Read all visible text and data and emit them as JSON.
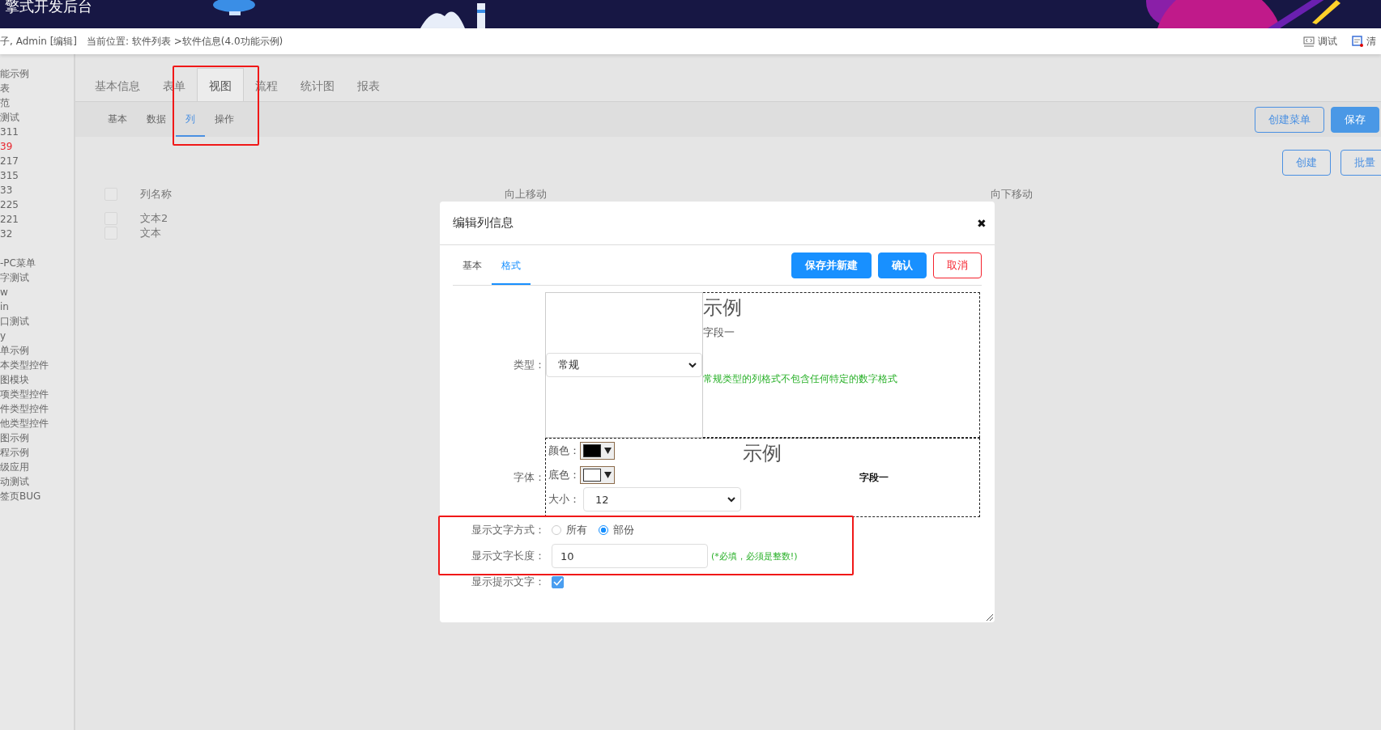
{
  "header": {
    "title": "擎式开发后台"
  },
  "breadcrumb": {
    "user": "子, Admin [编辑]",
    "location": "当前位置: 软件列表 >软件信息(4.0功能示例)"
  },
  "toolbar_links": [
    {
      "label": "调试",
      "kind": "debug"
    },
    {
      "label": "清",
      "kind": "clear"
    }
  ],
  "sidebar": {
    "groups": [
      {
        "items": [
          {
            "label": "能示例",
            "selected": false
          },
          {
            "label": "表",
            "selected": false
          },
          {
            "label": "范",
            "selected": false
          },
          {
            "label": "测试",
            "selected": false
          },
          {
            "label": "311",
            "selected": false
          },
          {
            "label": "39",
            "selected": true
          },
          {
            "label": "217",
            "selected": false
          },
          {
            "label": "315",
            "selected": false
          },
          {
            "label": "33",
            "selected": false
          },
          {
            "label": "225",
            "selected": false
          },
          {
            "label": "221",
            "selected": false
          },
          {
            "label": "32",
            "selected": false
          }
        ]
      },
      {
        "items": [
          {
            "label": "-PC菜单",
            "selected": false
          },
          {
            "label": "字测试",
            "selected": false
          },
          {
            "label": "w",
            "selected": false
          },
          {
            "label": "in",
            "selected": false
          },
          {
            "label": "口测试",
            "selected": false
          },
          {
            "label": "y",
            "selected": false
          },
          {
            "label": "单示例",
            "selected": false
          },
          {
            "label": "本类型控件",
            "selected": false
          },
          {
            "label": "图模块",
            "selected": false
          },
          {
            "label": "项类型控件",
            "selected": false
          },
          {
            "label": "件类型控件",
            "selected": false
          },
          {
            "label": "他类型控件",
            "selected": false
          },
          {
            "label": "图示例",
            "selected": false
          },
          {
            "label": "程示例",
            "selected": false
          },
          {
            "label": "级应用",
            "selected": false
          },
          {
            "label": "动测试",
            "selected": false
          },
          {
            "label": "签页BUG",
            "selected": false
          }
        ]
      }
    ]
  },
  "tabs": [
    {
      "label": "基本信息",
      "selected": false
    },
    {
      "label": "表单",
      "selected": false
    },
    {
      "label": "视图",
      "selected": true
    },
    {
      "label": "流程",
      "selected": false
    },
    {
      "label": "统计图",
      "selected": false
    },
    {
      "label": "报表",
      "selected": false
    }
  ],
  "subtabs": [
    {
      "label": "基本",
      "selected": false
    },
    {
      "label": "数据",
      "selected": false
    },
    {
      "label": "列",
      "selected": true
    },
    {
      "label": "操作",
      "selected": false
    }
  ],
  "header_buttons": [
    {
      "label": "创建菜单",
      "kind": "outline"
    },
    {
      "label": "保存",
      "kind": "primary"
    }
  ],
  "list_buttons": [
    {
      "label": "创建",
      "kind": "outline"
    },
    {
      "label": "批量",
      "kind": "outline"
    }
  ],
  "table": {
    "header_checked": false,
    "columns": [
      "列名称",
      "向上移动",
      "向下移动"
    ],
    "rows": [
      {
        "name": "文本2",
        "checked": false
      },
      {
        "name": "文本",
        "checked": false
      }
    ]
  },
  "dialog": {
    "title": "编辑列信息",
    "close": "✖",
    "tabs": [
      {
        "label": "基本",
        "selected": false
      },
      {
        "label": "格式",
        "selected": true
      }
    ],
    "buttons": [
      {
        "label": "保存并新建",
        "kind": "primary"
      },
      {
        "label": "确认",
        "kind": "primary"
      },
      {
        "label": "取消",
        "kind": "danger"
      }
    ],
    "type_field": {
      "label": "类型：",
      "value": "常规",
      "preview_title": "示例",
      "preview_field": "字段一",
      "note": "常规类型的列格式不包含任何特定的数字格式"
    },
    "font_field": {
      "label": "字体：",
      "swatches": [
        {
          "label": "颜色：",
          "color": "#000000"
        },
        {
          "label": "底色：",
          "color": "#ffffff"
        }
      ],
      "size_label": "大小：",
      "size": "12",
      "preview_title": "示例",
      "preview_field": "字段一"
    },
    "display_mode": {
      "label": "显示文字方式：",
      "options": [
        {
          "label": "所有",
          "selected": false
        },
        {
          "label": "部份",
          "selected": true
        }
      ]
    },
    "text_length": {
      "label": "显示文字长度：",
      "value": "10",
      "hint": "(*必填，必须是整数!)"
    },
    "show_tooltip": {
      "label": "显示提示文字：",
      "checked": true
    }
  }
}
